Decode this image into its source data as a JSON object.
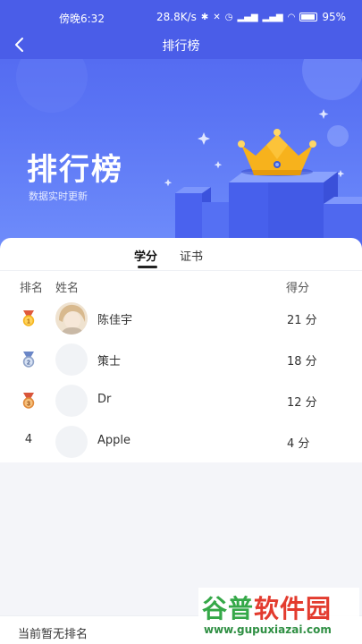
{
  "status_bar": {
    "time": "傍晚6:32",
    "speed": "28.8K/s",
    "battery": "95%"
  },
  "navbar": {
    "title": "排行榜",
    "back_icon": "chevron-left-icon"
  },
  "hero": {
    "title": "排行榜",
    "subtitle": "数据实时更新"
  },
  "tabs": [
    {
      "label": "学分",
      "active": true
    },
    {
      "label": "证书",
      "active": false
    }
  ],
  "table": {
    "headers": {
      "rank": "排名",
      "name": "姓名",
      "score": "得分"
    },
    "rows": [
      {
        "rank": "1",
        "medal": "gold-medal-icon",
        "name": "陈佳宇",
        "score": "21 分",
        "avatar": "photo"
      },
      {
        "rank": "2",
        "medal": "silver-medal-icon",
        "name": "策士",
        "score": "18 分",
        "avatar": "blank"
      },
      {
        "rank": "3",
        "medal": "bronze-medal-icon",
        "name": "Dr",
        "score": "12 分",
        "avatar": "blank"
      },
      {
        "rank": "4",
        "medal": null,
        "name": "Apple",
        "score": "4 分",
        "avatar": "blank"
      }
    ]
  },
  "footer": {
    "my_rank_text": "当前暂无排名"
  },
  "watermark": {
    "brand_g1": "谷普",
    "brand_rest": "软件园",
    "url": "www.gupuxiazai.com"
  },
  "colors": {
    "header_blue": "#4a5de8",
    "gold": "#f5b51f",
    "silver": "#8fa3c9",
    "bronze": "#e08a3c"
  }
}
